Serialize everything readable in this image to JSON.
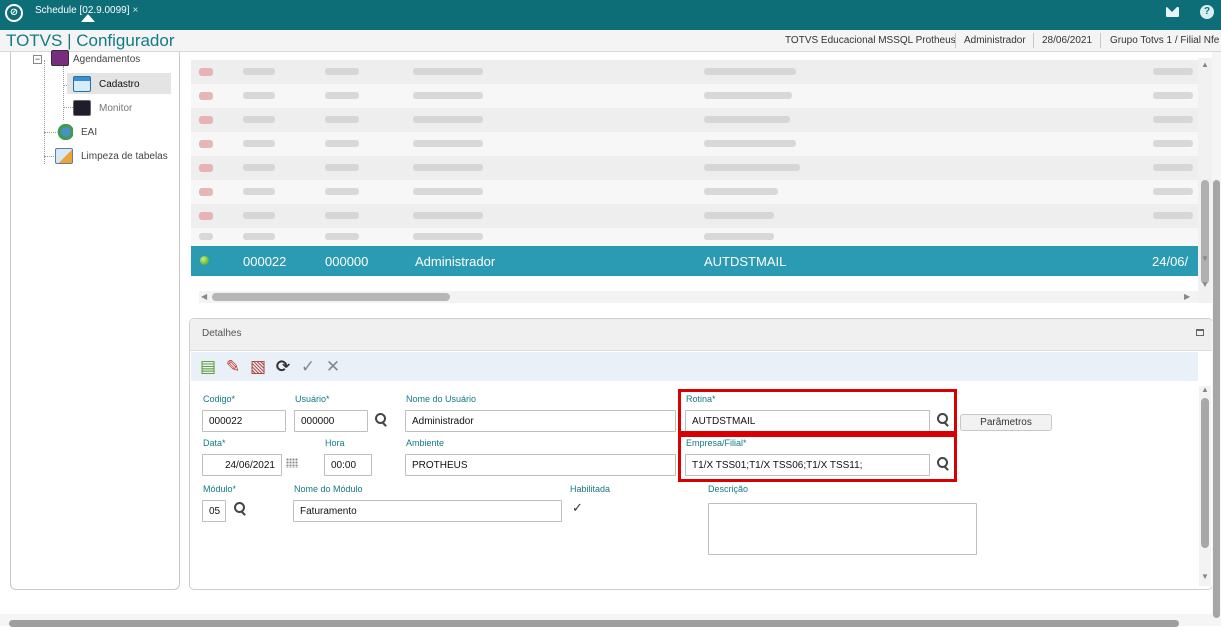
{
  "topbar": {
    "tab_label": "Schedule [02.9.0099]",
    "tab_close": "×",
    "logo_glyph": "⊘",
    "help_glyph": "?",
    "color": "#0e6e78"
  },
  "header": {
    "title": "TOTVS | Configurador",
    "environment": "TOTVS Educacional MSSQL Protheus",
    "user": "Administrador",
    "date": "28/06/2021",
    "branch": "Grupo Totvs 1 / Filial Nfe"
  },
  "tree": {
    "items": [
      {
        "label": "Agendamentos",
        "icon": "schedule-icon"
      },
      {
        "label": "Cadastro",
        "icon": "register-icon",
        "selected": true
      },
      {
        "label": "Monitor",
        "icon": "monitor-icon"
      },
      {
        "label": "EAI",
        "icon": "puzzle-icon"
      },
      {
        "label": "Limpeza de tabelas",
        "icon": "table-clean-icon"
      }
    ]
  },
  "grid": {
    "selected_row": {
      "status": "green",
      "codigo": "000022",
      "usuario": "000000",
      "nome": "Administrador",
      "rotina": "AUTDSTMAIL",
      "data": "24/06/"
    }
  },
  "details": {
    "title": "Detalhes",
    "fields": {
      "codigo": {
        "label": "Codigo*",
        "value": "000022"
      },
      "usuario": {
        "label": "Usuário*",
        "value": "000000"
      },
      "nome_usuario": {
        "label": "Nome do Usuário",
        "value": "Administrador"
      },
      "rotina": {
        "label": "Rotina*",
        "value": "AUTDSTMAIL"
      },
      "data": {
        "label": "Data*",
        "value": "24/06/2021"
      },
      "hora": {
        "label": "Hora",
        "value": "00:00"
      },
      "ambiente": {
        "label": "Ambiente",
        "value": "PROTHEUS"
      },
      "empresa_filial": {
        "label": "Empresa/Filial*",
        "value": "T1/X TSS01;T1/X TSS06;T1/X TSS11;"
      },
      "modulo": {
        "label": "Módulo*",
        "value": "05"
      },
      "nome_modulo": {
        "label": "Nome do Módulo",
        "value": "Faturamento"
      },
      "habilitada": {
        "label": "Habilitada",
        "checked": true,
        "glyph": "✓"
      },
      "descricao": {
        "label": "Descrição",
        "value": ""
      }
    },
    "parametros_label": "Parâmetros",
    "highlight_color": "#d80000"
  }
}
